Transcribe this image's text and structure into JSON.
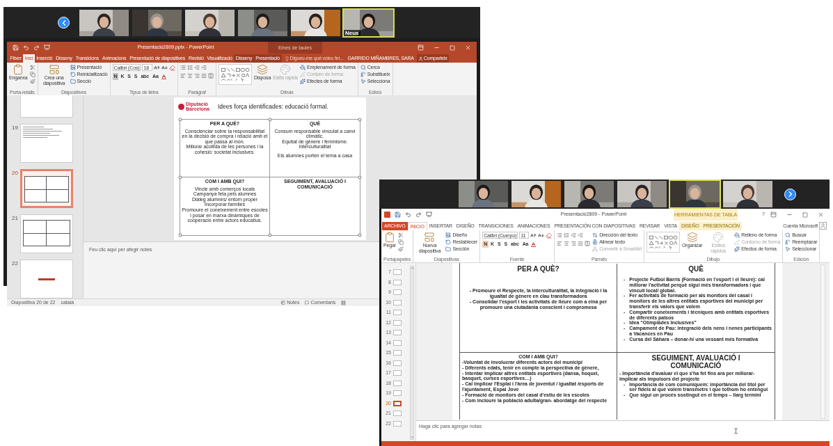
{
  "windows": [
    {
      "kind": "office2016",
      "call_tiles": [
        {
          "kind": "picture",
          "speaking": false
        },
        {
          "kind": "picture",
          "speaking": false
        },
        {
          "kind": "picture",
          "speaking": false
        },
        {
          "kind": "picture",
          "speaking": false
        },
        {
          "kind": "picture",
          "speaking": false
        },
        {
          "kind": "picture",
          "speaking": true,
          "label": "Neus"
        }
      ],
      "title": "Presentació2809.pptx - PowerPoint",
      "context_header": "Eines de taules",
      "tabs": [
        {
          "label": "Fitxer",
          "selected": false,
          "contextual": false
        },
        {
          "label": "Inici",
          "selected": true,
          "contextual": false
        },
        {
          "label": "Inserció",
          "selected": false,
          "contextual": false
        },
        {
          "label": "Disseny",
          "selected": false,
          "contextual": false
        },
        {
          "label": "Transicions",
          "selected": false,
          "contextual": false
        },
        {
          "label": "Animacions",
          "selected": false,
          "contextual": false
        },
        {
          "label": "Presentació de diapositives",
          "selected": false,
          "contextual": false
        },
        {
          "label": "Revisió",
          "selected": false,
          "contextual": false
        },
        {
          "label": "Visualització",
          "selected": false,
          "contextual": false
        },
        {
          "label": "Disseny",
          "selected": false,
          "contextual": true
        },
        {
          "label": "Presentació",
          "selected": false,
          "contextual": true
        }
      ],
      "tell_me": "Digueu-me què voleu fer...",
      "user": "GARRIDO MIÑAMBRES, SARA",
      "share": "Comparteix",
      "ribbon": [
        {
          "title": "Porta-retalls",
          "items": [
            {
              "kind": "paste",
              "label": "Enganxa",
              "disabled": false
            },
            {
              "kind": "clipboard_tools"
            }
          ]
        },
        {
          "title": "Diapositives",
          "items": [
            {
              "kind": "new_slide",
              "label": "Crea una diapositiva",
              "disabled": false
            },
            {
              "kind": "slide_commands",
              "items": [
                {
                  "label": "Presentació",
                  "disabled": false
                },
                {
                  "label": "Reinicialització",
                  "disabled": false
                },
                {
                  "label": "Secció",
                  "disabled": false
                }
              ]
            }
          ]
        },
        {
          "title": "Tipus de lletra",
          "items": [
            {
              "kind": "font",
              "font": "Calibri (Cos)",
              "size": "18",
              "buttons": [
                {
                  "label": "N",
                  "selected": true
                },
                {
                  "label": "K",
                  "selected": false
                },
                {
                  "label": "S",
                  "selected": false
                },
                {
                  "label": "S",
                  "selected": false
                },
                {
                  "label": "abc",
                  "selected": false
                },
                {
                  "label": "Aa",
                  "selected": false
                }
              ]
            }
          ]
        },
        {
          "title": "Paràgraf",
          "items": [
            {
              "kind": "paragraph"
            }
          ]
        },
        {
          "title": "Dibuix",
          "items": [
            {
              "kind": "shapes"
            },
            {
              "kind": "arrange",
              "label": "Disposa",
              "disabled": false
            },
            {
              "kind": "styles",
              "label": "Estils ràpids",
              "disabled": true
            },
            {
              "kind": "format_commands",
              "items": [
                {
                  "label": "Emplenament de forma",
                  "disabled": false
                },
                {
                  "label": "Contorn de forma",
                  "disabled": true
                },
                {
                  "label": "Efectes de forma",
                  "disabled": false
                }
              ]
            }
          ]
        },
        {
          "title": "Edició",
          "items": [
            {
              "kind": "edit_commands",
              "items": [
                {
                  "label": "Cerca",
                  "disabled": false
                },
                {
                  "label": "Substitueix",
                  "disabled": false
                },
                {
                  "label": "Selecciona",
                  "disabled": false
                }
              ]
            }
          ]
        }
      ],
      "thumbnails": [
        {
          "kind": "text",
          "selected": false
        },
        {
          "kind": "text",
          "number": "19",
          "selected": false
        },
        {
          "kind": "table",
          "number": "20",
          "selected": true
        },
        {
          "kind": "table",
          "number": "21",
          "selected": false
        },
        {
          "kind": "title",
          "number": "22",
          "selected": false
        }
      ],
      "slide": {
        "logo": "Diputació Barcelona",
        "title": "Idees força identificades: educació formal.",
        "cells": [
          {
            "heading": "PER A QUÈ?",
            "blocks": [
              [
                "Conscienciar sobre la responsabilitat en la decisió de compra i relació amb el que passa al món.",
                "Millorar acollida de les persones i la cohesió: societat inclusives."
              ]
            ]
          },
          {
            "heading": "QUÈ",
            "blocks": [
              [
                "Consum responsable vinculat a canvi climàtic.",
                "Equitat de gènere i feminisme.",
                "Interculturalitat"
              ],
              [
                "Els alumnes porten el tema a casa"
              ]
            ]
          },
          {
            "heading": "COM I AMB QUI?",
            "blocks": [
              [
                "Vincle amb comerços locals",
                "Campanya feta pels alumnes",
                "Diàleg alumnes/ entorn proper",
                "Incorporar famílies",
                "Promoure el coneixement entre escoles i posar en marxa dinàmiques de cooperació entre actors educatius."
              ]
            ]
          },
          {
            "heading": "SEGUIMENT, AVALUACIÓ I COMUNICACIÓ"
          }
        ]
      },
      "notes_placeholder": "Feu clic aquí per afegir notes",
      "status": {
        "slide": "Diapositiva 20 de 22",
        "language": "català",
        "notes": "Notes",
        "comments": "Comentaris"
      }
    },
    {
      "kind": "office2013",
      "call_tiles": [
        {
          "kind": "picture",
          "speaking": false
        },
        {
          "kind": "picture",
          "speaking": false
        },
        {
          "kind": "picture",
          "speaking": false
        },
        {
          "kind": "picture",
          "speaking": false
        },
        {
          "kind": "picture",
          "speaking": true
        },
        {
          "kind": "picture",
          "speaking": false
        }
      ],
      "title": "Presentació2809 - PowerPoint",
      "context_header": "HERRAMIENTAS DE TABLA",
      "help": "?",
      "tabs": [
        {
          "label": "ARCHIVO",
          "kind": "file",
          "selected": false,
          "contextual": false
        },
        {
          "label": "INICIO",
          "kind": "tab",
          "selected": true,
          "contextual": false
        },
        {
          "label": "INSERTAR",
          "kind": "tab",
          "selected": false,
          "contextual": false
        },
        {
          "label": "DISEÑO",
          "kind": "tab",
          "selected": false,
          "contextual": false
        },
        {
          "label": "TRANSICIONES",
          "kind": "tab",
          "selected": false,
          "contextual": false
        },
        {
          "label": "ANIMACIONES",
          "kind": "tab",
          "selected": false,
          "contextual": false
        },
        {
          "label": "PRESENTACIÓN CON DIAPOSITIVAS",
          "kind": "tab",
          "selected": false,
          "contextual": false
        },
        {
          "label": "REVISAR",
          "kind": "tab",
          "selected": false,
          "contextual": false
        },
        {
          "label": "VISTA",
          "kind": "tab",
          "selected": false,
          "contextual": false
        },
        {
          "label": "DISEÑO",
          "kind": "tab",
          "selected": false,
          "contextual": true
        },
        {
          "label": "PRESENTACIÓN",
          "kind": "tab",
          "selected": false,
          "contextual": true
        }
      ],
      "user": "Cuenta Microsoft",
      "ribbon": [
        {
          "title": "Portapapeles",
          "items": [
            {
              "kind": "paste",
              "label": "Pegar",
              "disabled": false
            },
            {
              "kind": "clipboard_tools"
            }
          ]
        },
        {
          "title": "Diapositivas",
          "items": [
            {
              "kind": "new_slide",
              "label": "Nueva diapositiva",
              "disabled": false
            },
            {
              "kind": "slide_commands",
              "items": [
                {
                  "label": "Diseño",
                  "disabled": false
                },
                {
                  "label": "Restablecer",
                  "disabled": false
                },
                {
                  "label": "Sección",
                  "disabled": false
                }
              ]
            }
          ]
        },
        {
          "title": "Fuente",
          "items": [
            {
              "kind": "font",
              "font": "Calibri (Cuerpo)",
              "size": "11",
              "buttons": [
                {
                  "label": "N",
                  "selected": true
                },
                {
                  "label": "K",
                  "selected": false
                },
                {
                  "label": "S",
                  "selected": false
                },
                {
                  "label": "S",
                  "selected": false
                },
                {
                  "label": "abc",
                  "selected": false
                },
                {
                  "label": "Aa",
                  "selected": false
                }
              ]
            }
          ]
        },
        {
          "title": "Párrafo",
          "items": [
            {
              "kind": "paragraph"
            },
            {
              "kind": "text_commands",
              "items": [
                {
                  "label": "Dirección del texto",
                  "disabled": false
                },
                {
                  "label": "Alinear texto",
                  "disabled": false
                },
                {
                  "label": "Convertir a SmartArt",
                  "disabled": true
                }
              ]
            }
          ]
        },
        {
          "title": "Dibujo",
          "items": [
            {
              "kind": "shapes"
            },
            {
              "kind": "arrange",
              "label": "Organizar",
              "disabled": false
            },
            {
              "kind": "styles",
              "label": "Estilos rápidos",
              "disabled": true
            },
            {
              "kind": "format_commands",
              "items": [
                {
                  "label": "Relleno de forma",
                  "disabled": false
                },
                {
                  "label": "Contorno de forma",
                  "disabled": true
                },
                {
                  "label": "Efectos de forma",
                  "disabled": false
                }
              ]
            }
          ]
        },
        {
          "title": "Edición",
          "items": [
            {
              "kind": "edit_commands",
              "items": [
                {
                  "label": "Buscar",
                  "disabled": false
                },
                {
                  "label": "Reemplazar",
                  "disabled": false
                },
                {
                  "label": "Seleccionar",
                  "disabled": false
                }
              ]
            }
          ]
        }
      ],
      "thumbnails": [
        {
          "number": "7",
          "selected": false
        },
        {
          "number": "8",
          "selected": false
        },
        {
          "number": "9",
          "selected": false
        },
        {
          "number": "10",
          "selected": false
        },
        {
          "number": "11",
          "selected": false
        },
        {
          "number": "12",
          "selected": false
        },
        {
          "number": "13",
          "selected": false
        },
        {
          "number": "14",
          "selected": false
        },
        {
          "number": "15",
          "selected": false
        },
        {
          "number": "16",
          "selected": false
        },
        {
          "number": "17",
          "selected": false
        },
        {
          "number": "18",
          "selected": false
        },
        {
          "number": "19",
          "selected": false
        },
        {
          "number": "20",
          "selected": true
        },
        {
          "number": "21",
          "selected": false
        },
        {
          "number": "22",
          "selected": false
        }
      ],
      "slide": {
        "cells": [
          {
            "heading": "PER A QUÈ?",
            "kind": "centered",
            "lines": [
              {
                "kind": "plain",
                "text": "- Promoure el Respecte, la interculturalitat, la integració i la igualtat de gènere en clau transformadora"
              },
              {
                "kind": "plain",
                "text": "- Consolidar l'esport i les activitats de lleure com a eina per promoure una ciutadania conscient i compromesa"
              }
            ]
          },
          {
            "heading": "QUÈ",
            "kind": "list",
            "lines": [
              {
                "kind": "bullet",
                "marker": "-",
                "text": "Projecte Futbol Barris (Formació en l'esport i el lleure): cal millorar l'activitat perquè sigui més transformadora i que vinculi local/ global."
              },
              {
                "kind": "bullet",
                "marker": "-",
                "text": "Fer activitats de formació per als monitors del casal i monitors de les altres entitats esportives del municipi per transferir els valors que volem"
              },
              {
                "kind": "bullet",
                "marker": "-",
                "text": "Compartir coneixements i tècniques amb entitats esportives de diferents països"
              },
              {
                "kind": "bullet",
                "marker": "-",
                "text": "Idea “Olimpiades Inclusives”"
              },
              {
                "kind": "bullet",
                "marker": "-",
                "text": "Campament de Pau: integració dels nens i nenes participants a Vacances en Pau"
              },
              {
                "kind": "bullet",
                "marker": "-",
                "text": "Cursa del Sàhara – donar-hi una vessant més formativa"
              }
            ]
          },
          {
            "heading": "COM I AMB QUI?",
            "kind": "list_small_heading",
            "lines": [
              {
                "kind": "plain",
                "text": "-Voluntat de involucrar diferents actors del municipi"
              },
              {
                "kind": "plain",
                "text": "- Diferents edats, tenir en compte la perspectiva de gènere,"
              },
              {
                "kind": "plain",
                "text": "- Intentar implicar altres entitats esportives (dansa, hoquei, basquet, curses esportives…)"
              },
              {
                "kind": "plain",
                "text": "- Cal implicar l'Esplai i l'àrea de joventut / igualtat /esports de l'ajuntament, Espai Jove"
              },
              {
                "kind": "plain",
                "text": "- Formació de monitors del casal d'estiu de les escoles"
              },
              {
                "kind": "plain",
                "text": "- Com incloure la població adulta/gran- abordatge del respecte"
              }
            ]
          },
          {
            "heading": "SEGUIMENT, AVALUACIÓ I COMUNICACIÓ",
            "kind": "list",
            "lines": [
              {
                "kind": "plain",
                "text": "- Importància d'avaluar el que s'ha fet fins ara per millorar-implicar als  impulsors del projecte"
              },
              {
                "kind": "bullet",
                "marker": "-",
                "text": "Importància de com comuniquem: importància del títol per ser fidels al què volem transmetre i que tothom ho entengui"
              },
              {
                "kind": "bullet",
                "marker": "-",
                "text": "Que sigui un procés sostingut en el temps – llarg termini"
              }
            ]
          }
        ]
      },
      "notes_placeholder": "Haga clic para agregar notas"
    }
  ]
}
